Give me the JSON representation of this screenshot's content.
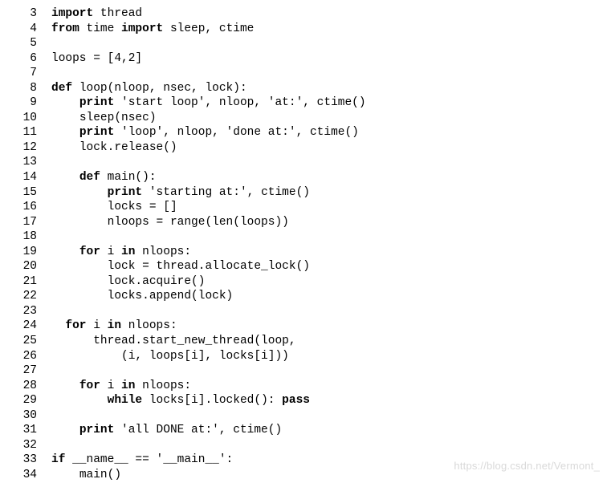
{
  "code": {
    "lines": [
      {
        "n": 3,
        "segments": [
          {
            "indent": 0
          },
          {
            "t": "import ",
            "kw": true
          },
          {
            "t": "thread"
          }
        ]
      },
      {
        "n": 4,
        "segments": [
          {
            "indent": 0
          },
          {
            "t": "from ",
            "kw": true
          },
          {
            "t": "time "
          },
          {
            "t": "import ",
            "kw": true
          },
          {
            "t": "sleep, ctime"
          }
        ]
      },
      {
        "n": 5,
        "segments": [
          {
            "indent": 0
          },
          {
            "t": ""
          }
        ]
      },
      {
        "n": 6,
        "segments": [
          {
            "indent": 0
          },
          {
            "t": "loops = [4,2]"
          }
        ]
      },
      {
        "n": 7,
        "segments": [
          {
            "indent": 0
          },
          {
            "t": ""
          }
        ]
      },
      {
        "n": 8,
        "segments": [
          {
            "indent": 0
          },
          {
            "t": "def ",
            "kw": true
          },
          {
            "t": "loop(nloop, nsec, lock):"
          }
        ]
      },
      {
        "n": 9,
        "segments": [
          {
            "indent": 1
          },
          {
            "t": "print ",
            "kw": true
          },
          {
            "t": "'start loop', nloop, 'at:', ctime()"
          }
        ]
      },
      {
        "n": 10,
        "segments": [
          {
            "indent": 1
          },
          {
            "t": "sleep(nsec)"
          }
        ]
      },
      {
        "n": 11,
        "segments": [
          {
            "indent": 1
          },
          {
            "t": "print ",
            "kw": true
          },
          {
            "t": "'loop', nloop, 'done at:', ctime()"
          }
        ]
      },
      {
        "n": 12,
        "segments": [
          {
            "indent": 1
          },
          {
            "t": "lock.release()"
          }
        ]
      },
      {
        "n": 13,
        "segments": [
          {
            "indent": 0
          },
          {
            "t": ""
          }
        ]
      },
      {
        "n": 14,
        "segments": [
          {
            "indent": 1
          },
          {
            "t": "def ",
            "kw": true
          },
          {
            "t": "main():"
          }
        ]
      },
      {
        "n": 15,
        "segments": [
          {
            "indent": 2
          },
          {
            "t": "print ",
            "kw": true
          },
          {
            "t": "'starting at:', ctime()"
          }
        ]
      },
      {
        "n": 16,
        "segments": [
          {
            "indent": 2
          },
          {
            "t": "locks = []"
          }
        ]
      },
      {
        "n": 17,
        "segments": [
          {
            "indent": 2
          },
          {
            "t": "nloops = range(len(loops))"
          }
        ]
      },
      {
        "n": 18,
        "segments": [
          {
            "indent": 0
          },
          {
            "t": ""
          }
        ]
      },
      {
        "n": 19,
        "segments": [
          {
            "indent": 1
          },
          {
            "t": "for ",
            "kw": true
          },
          {
            "t": "i "
          },
          {
            "t": "in ",
            "kw": true
          },
          {
            "t": "nloops:"
          }
        ]
      },
      {
        "n": 20,
        "segments": [
          {
            "indent": 2
          },
          {
            "t": "lock = thread.allocate_lock()"
          }
        ]
      },
      {
        "n": 21,
        "segments": [
          {
            "indent": 2
          },
          {
            "t": "lock.acquire()"
          }
        ]
      },
      {
        "n": 22,
        "segments": [
          {
            "indent": 2
          },
          {
            "t": "locks.append(lock)"
          }
        ]
      },
      {
        "n": 23,
        "segments": [
          {
            "indent": 0
          },
          {
            "t": ""
          }
        ]
      },
      {
        "n": 24,
        "segments": [
          {
            "indent": 0,
            "half": true
          },
          {
            "t": "for ",
            "kw": true
          },
          {
            "t": "i "
          },
          {
            "t": "in ",
            "kw": true
          },
          {
            "t": "nloops:"
          }
        ]
      },
      {
        "n": 25,
        "segments": [
          {
            "indent": 1,
            "half": true
          },
          {
            "t": "thread.start_new_thread(loop,"
          }
        ]
      },
      {
        "n": 26,
        "segments": [
          {
            "indent": 2,
            "half": true
          },
          {
            "t": "(i, loops[i], locks[i]))"
          }
        ]
      },
      {
        "n": 27,
        "segments": [
          {
            "indent": 0
          },
          {
            "t": ""
          }
        ]
      },
      {
        "n": 28,
        "segments": [
          {
            "indent": 1
          },
          {
            "t": "for ",
            "kw": true
          },
          {
            "t": "i "
          },
          {
            "t": "in ",
            "kw": true
          },
          {
            "t": "nloops:"
          }
        ]
      },
      {
        "n": 29,
        "segments": [
          {
            "indent": 2
          },
          {
            "t": "while ",
            "kw": true
          },
          {
            "t": "locks[i].locked(): "
          },
          {
            "t": "pass",
            "kw": true
          }
        ]
      },
      {
        "n": 30,
        "segments": [
          {
            "indent": 0
          },
          {
            "t": ""
          }
        ]
      },
      {
        "n": 31,
        "segments": [
          {
            "indent": 1
          },
          {
            "t": "print ",
            "kw": true
          },
          {
            "t": "'all DONE at:', ctime()"
          }
        ]
      },
      {
        "n": 32,
        "segments": [
          {
            "indent": 0
          },
          {
            "t": ""
          }
        ]
      },
      {
        "n": 33,
        "segments": [
          {
            "indent": 0
          },
          {
            "t": "if ",
            "kw": true
          },
          {
            "t": "__name__ == '__main__':"
          }
        ]
      },
      {
        "n": 34,
        "segments": [
          {
            "indent": 1
          },
          {
            "t": "main()"
          }
        ]
      }
    ],
    "indent_unit": "    ",
    "half_indent": "  "
  },
  "watermark": "https://blog.csdn.net/Vermont_"
}
